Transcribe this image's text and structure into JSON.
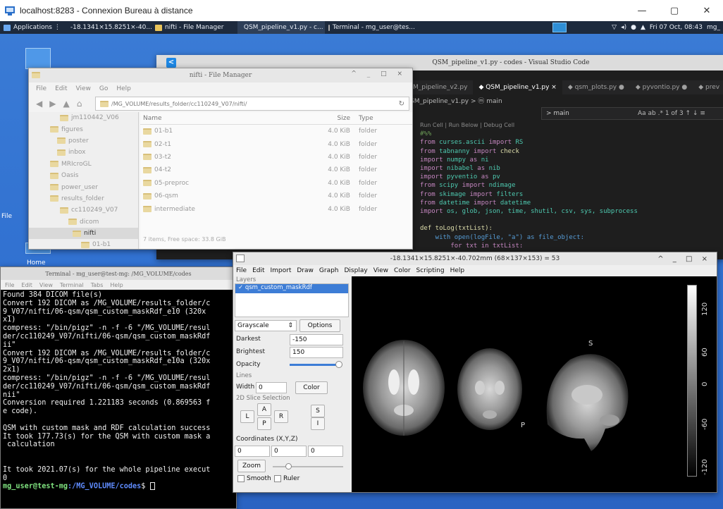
{
  "rdp": {
    "title": "localhost:8283 - Connexion Bureau à distance",
    "minimize": "—",
    "maximize": "▢",
    "close": "✕"
  },
  "panel": {
    "applications": "Applications",
    "task_volume": "-18.1341×15.8251×-40...",
    "task_files": "nifti - File Manager",
    "task_vscode": "QSM_pipeline_v1.py - c...",
    "task_terminal": "Terminal - mg_user@tes...",
    "clock": "Fri 07 Oct, 08:43",
    "user": "mg_"
  },
  "desktop": {
    "home_label": "Home",
    "file_label": "File"
  },
  "vscode": {
    "title": "QSM_pipeline_v1.py - codes - Visual Studio Code",
    "logo": "<",
    "tabs": [
      {
        "label": "M_pipeline_v2.py"
      },
      {
        "label": "◆ QSM_pipeline_v1.py ×"
      },
      {
        "label": "◆ qsm_plots.py ●"
      },
      {
        "label": "◆ pyvontio.py ●"
      },
      {
        "label": "◆ prev"
      }
    ],
    "breadcrumb": "SM_pipeline_v1.py > ⓜ main",
    "find_text": "> main",
    "find_opts": "Aa  ab  .*  1 of 3    ↑  ↓  ≡",
    "run_cell": "Run Cell | Run Below | Debug Cell",
    "code": [
      {
        "k": "",
        "m": "",
        "t": "#%%"
      },
      {
        "k": "from",
        "m": "curses.ascii",
        "i": "import",
        "n": "RS"
      },
      {
        "k": "from",
        "m": "tabnanny",
        "i": "import",
        "n": "check"
      },
      {
        "k": "import",
        "m": "numpy",
        "i": "as",
        "n": "ni"
      },
      {
        "k": "import",
        "m": "nibabel",
        "i": "as",
        "n": "nib"
      },
      {
        "k": "import",
        "m": "pyventio",
        "i": "as",
        "n": "pv"
      },
      {
        "k": "from",
        "m": "scipy",
        "i": "import",
        "n": "ndimage"
      },
      {
        "k": "from",
        "m": "skimage",
        "i": "import",
        "n": "filters"
      },
      {
        "k": "from",
        "m": "datetime",
        "i": "import",
        "n": "datetime"
      },
      {
        "k": "import",
        "m": "os, glob, json, time, shutil, csv, sys, subprocess",
        "i": "",
        "n": ""
      }
    ],
    "def_line": "def toLog(txtList):",
    "with_line": "    with open(logFile, \"a\") as file_object:",
    "for_line": "        for txt in txtList:"
  },
  "filemanager": {
    "title": "nifti - File Manager",
    "controls": "^ _ □ ×",
    "menu": [
      "File",
      "Edit",
      "View",
      "Go",
      "Help"
    ],
    "path": "/MG_VOLUME/results_folder/cc110249_V07/nifti/",
    "sidebar": [
      {
        "label": "jm110442_V06",
        "indent": 44,
        "sel": false
      },
      {
        "label": "figures",
        "indent": 30,
        "sel": false
      },
      {
        "label": "poster",
        "indent": 40,
        "sel": false
      },
      {
        "label": "inbox",
        "indent": 40,
        "sel": false
      },
      {
        "label": "MRIcroGL",
        "indent": 30,
        "sel": false
      },
      {
        "label": "Oasis",
        "indent": 30,
        "sel": false
      },
      {
        "label": "power_user",
        "indent": 30,
        "sel": false
      },
      {
        "label": "results_folder",
        "indent": 30,
        "sel": false
      },
      {
        "label": "cc110249_V07",
        "indent": 44,
        "sel": false
      },
      {
        "label": "dicom",
        "indent": 56,
        "sel": false
      },
      {
        "label": "nifti",
        "indent": 62,
        "sel": true
      },
      {
        "label": "01-b1",
        "indent": 74,
        "sel": false
      },
      {
        "label": "02-t1",
        "indent": 74,
        "sel": false
      }
    ],
    "columns": {
      "name": "Name",
      "size": "Size",
      "type": "Type"
    },
    "rows": [
      {
        "name": "01-b1",
        "size": "4.0 KiB",
        "type": "folder"
      },
      {
        "name": "02-t1",
        "size": "4.0 KiB",
        "type": "folder"
      },
      {
        "name": "03-t2",
        "size": "4.0 KiB",
        "type": "folder"
      },
      {
        "name": "04-t2",
        "size": "4.0 KiB",
        "type": "folder"
      },
      {
        "name": "05-preproc",
        "size": "4.0 KiB",
        "type": "folder"
      },
      {
        "name": "06-qsm",
        "size": "4.0 KiB",
        "type": "folder"
      },
      {
        "name": "intermediate",
        "size": "4.0 KiB",
        "type": "folder"
      }
    ],
    "status": "7 items, Free space: 33.8 GiB"
  },
  "terminal": {
    "title": "Terminal - mg_user@test-mg: /MG_VOLUME/codes",
    "menu": [
      "File",
      "Edit",
      "View",
      "Terminal",
      "Tabs",
      "Help"
    ],
    "lines": [
      "Found 384 DICOM file(s)",
      "Convert 192 DICOM as /MG_VOLUME/results_folder/c",
      "9_V07/nifti/06-qsm/qsm_custom_maskRdf_e10 (320x",
      "x1)",
      "compress: \"/bin/pigz\" -n -f -6 \"/MG_VOLUME/resul",
      "der/cc110249_V07/nifti/06-qsm/qsm_custom_maskRdf",
      "ii\"",
      "Convert 192 DICOM as /MG_VOLUME/results_folder/c",
      "9_V07/nifti/06-qsm/qsm_custom_maskRdf_e10a (320x",
      "2x1)",
      "compress: \"/bin/pigz\" -n -f -6 \"/MG_VOLUME/resul",
      "der/cc110249_V07/nifti/06-qsm/qsm_custom_maskRdf",
      "nii\"",
      "Conversion required 1.221183 seconds (0.869563 f",
      "e code).",
      "",
      "QSM with custom mask and RDF calculation success",
      "It took 177.73(s) for the QSM with custom mask a",
      " calculation",
      "",
      "",
      "It took 2021.07(s) for the whole pipeline execut",
      "0"
    ],
    "prompt_user": "mg_user@test-mg",
    "prompt_path": ":/MG_VOLUME/codes",
    "prompt_end": "$ "
  },
  "mricrogl": {
    "title": "-18.1341×15.8251×-40.702mm (68×137×153) = 53",
    "controls": "^ _ □ ×",
    "menu": [
      "File",
      "Edit",
      "Import",
      "Draw",
      "Graph",
      "Display",
      "View",
      "Color",
      "Scripting",
      "Help"
    ],
    "layers_label": "Layers",
    "layer_name": "✓ qsm_custom_maskRdf",
    "colormap": "Grayscale",
    "options_btn": "Options",
    "darkest_label": "Darkest",
    "darkest_value": "-150",
    "brightest_label": "Brightest",
    "brightest_value": "150",
    "opacity_label": "Opacity",
    "opacity_level": 0.95,
    "lines_label": "Lines",
    "width_label": "Width",
    "width_value": "0",
    "color_btn": "Color",
    "slice_label": "2D Slice Selection",
    "btn_a": "A",
    "btn_l": "L",
    "btn_r": "R",
    "btn_p": "P",
    "btn_s": "S",
    "btn_i": "I",
    "coords_label": "Coordinates (X,Y,Z)",
    "coord_x": "0",
    "coord_y": "0",
    "coord_z": "0",
    "zoom_btn": "Zoom",
    "smooth_label": "Smooth",
    "ruler_label": "Ruler",
    "view_s": "S",
    "view_p": "P",
    "cb_ticks": [
      "120",
      "60",
      "0",
      "-60",
      "-120"
    ]
  }
}
